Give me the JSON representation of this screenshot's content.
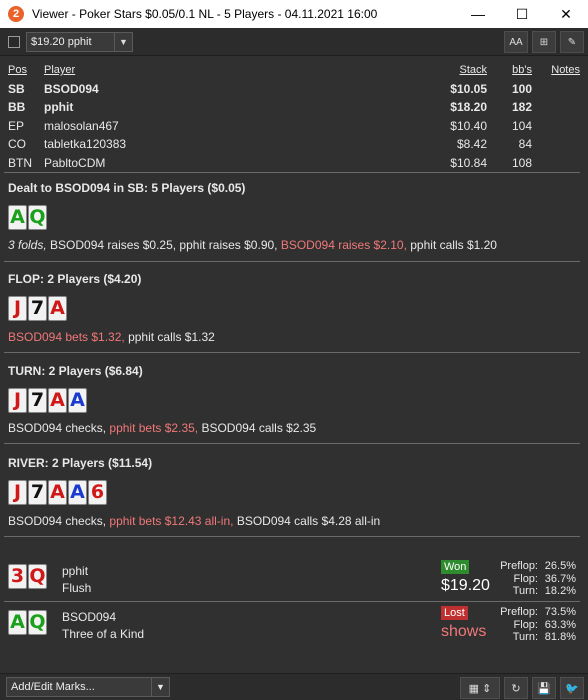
{
  "window": {
    "app_icon": "2",
    "title": "Viewer - Poker Stars $0.05/0.1 NL - 5 Players - 04.11.2021 16:00",
    "minimize": "—",
    "maximize": "☐",
    "close": "✕"
  },
  "toolbar": {
    "hand_select": "$19.20 pphit",
    "font_btn": "AA",
    "grid_btn": "⊞",
    "edit_btn": "✎"
  },
  "players_table": {
    "headers": {
      "pos": "Pos",
      "player": "Player",
      "stack": "Stack",
      "bbs": "bb's",
      "notes": "Notes"
    },
    "rows": [
      {
        "pos": "SB",
        "player": "BSOD094",
        "stack": "$10.05",
        "bbs": "100",
        "bold": true
      },
      {
        "pos": "BB",
        "player": "pphit",
        "stack": "$18.20",
        "bbs": "182",
        "bold": true
      },
      {
        "pos": "EP",
        "player": "malosolan467",
        "stack": "$10.40",
        "bbs": "104",
        "bold": false
      },
      {
        "pos": "CO",
        "player": "tabletka120383",
        "stack": "$8.42",
        "bbs": "84",
        "bold": false
      },
      {
        "pos": "BTN",
        "player": "PabltoCDM",
        "stack": "$10.84",
        "bbs": "108",
        "bold": false
      }
    ]
  },
  "preflop": {
    "heading": "Dealt to BSOD094 in SB: 5 Players ($0.05)",
    "cards": [
      {
        "rank": "A",
        "color": "#1aa01a"
      },
      {
        "rank": "Q",
        "color": "#1aa01a"
      }
    ],
    "actions": [
      {
        "text": "3 folds, ",
        "style": "it"
      },
      {
        "text": "BSOD094 raises $0.25, pphit raises $0.90, ",
        "style": ""
      },
      {
        "text": "BSOD094 raises $2.10, ",
        "style": "red"
      },
      {
        "text": "pphit calls $1.20",
        "style": ""
      }
    ]
  },
  "flop": {
    "heading": "FLOP: 2 Players ($4.20)",
    "cards": [
      {
        "rank": "J",
        "color": "#d01818"
      },
      {
        "rank": "7",
        "color": "#111111"
      },
      {
        "rank": "A",
        "color": "#d01818"
      }
    ],
    "actions": [
      {
        "text": "BSOD094 bets $1.32, ",
        "style": "red"
      },
      {
        "text": "pphit calls $1.32",
        "style": ""
      }
    ]
  },
  "turn": {
    "heading": "TURN: 2 Players ($6.84)",
    "cards": [
      {
        "rank": "J",
        "color": "#d01818"
      },
      {
        "rank": "7",
        "color": "#111111"
      },
      {
        "rank": "A",
        "color": "#d01818"
      },
      {
        "rank": "A",
        "color": "#1a3ad0"
      }
    ],
    "actions": [
      {
        "text": "BSOD094 checks, ",
        "style": ""
      },
      {
        "text": "pphit bets $2.35, ",
        "style": "red"
      },
      {
        "text": "BSOD094 calls $2.35",
        "style": ""
      }
    ]
  },
  "river": {
    "heading": "RIVER: 2 Players ($11.54)",
    "cards": [
      {
        "rank": "J",
        "color": "#d01818"
      },
      {
        "rank": "7",
        "color": "#111111"
      },
      {
        "rank": "A",
        "color": "#d01818"
      },
      {
        "rank": "A",
        "color": "#1a3ad0"
      },
      {
        "rank": "6",
        "color": "#d01818"
      }
    ],
    "actions": [
      {
        "text": "BSOD094 checks, ",
        "style": ""
      },
      {
        "text": "pphit bets $12.43 all-in, ",
        "style": "red"
      },
      {
        "text": "BSOD094 calls $4.28 all-in",
        "style": ""
      }
    ]
  },
  "results": [
    {
      "cards": [
        {
          "rank": "3",
          "color": "#d01818"
        },
        {
          "rank": "Q",
          "color": "#d01818"
        }
      ],
      "player": "pphit",
      "hand": "Flush",
      "badge": "Won",
      "badge_color": "#2e8b2e",
      "amount": "$19.20",
      "amount_color": "#ffffff",
      "stats": [
        {
          "label": "Preflop:",
          "value": "26.5%"
        },
        {
          "label": "Flop:",
          "value": "36.7%"
        },
        {
          "label": "Turn:",
          "value": "18.2%"
        }
      ]
    },
    {
      "cards": [
        {
          "rank": "A",
          "color": "#1aa01a"
        },
        {
          "rank": "Q",
          "color": "#1aa01a"
        }
      ],
      "player": "BSOD094",
      "hand": "Three of a Kind",
      "badge": "Lost",
      "badge_color": "#c03030",
      "amount": "shows",
      "amount_color": "#f07878",
      "stats": [
        {
          "label": "Preflop:",
          "value": "73.5%"
        },
        {
          "label": "Flop:",
          "value": "63.3%"
        },
        {
          "label": "Turn:",
          "value": "81.8%"
        }
      ]
    }
  ],
  "bottombar": {
    "marks_select": "Add/Edit Marks...",
    "calendar_btn": "▦",
    "updown_btn": "⇕",
    "refresh_btn": "↻",
    "save_btn": "💾",
    "twitter_btn": "🐦"
  }
}
